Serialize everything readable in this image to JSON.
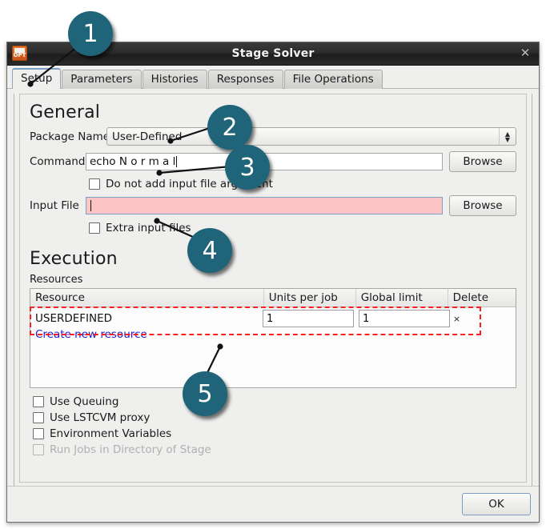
{
  "window": {
    "title": "Stage Solver",
    "icon": "opt-book-icon",
    "icon_text": "OPT",
    "close_label": "✕"
  },
  "tabs": [
    {
      "label": "Setup",
      "active": true
    },
    {
      "label": "Parameters",
      "active": false
    },
    {
      "label": "Histories",
      "active": false
    },
    {
      "label": "Responses",
      "active": false
    },
    {
      "label": "File Operations",
      "active": false
    }
  ],
  "general": {
    "heading": "General",
    "package_name_label": "Package Name",
    "package_name_value": "User-Defined",
    "command_label": "Command",
    "command_value": "echo N o r m a l",
    "browse_label": "Browse",
    "no_input_arg_label": "Do not add input file argument",
    "no_input_arg_checked": false,
    "input_file_label": "Input File",
    "input_file_value": "",
    "input_file_browse_label": "Browse",
    "extra_input_files_label": "Extra input files",
    "extra_input_files_checked": false
  },
  "execution": {
    "heading": "Execution",
    "resources_label": "Resources",
    "table": {
      "columns": [
        "Resource",
        "Units per job",
        "Global limit",
        "Delete"
      ],
      "rows": [
        {
          "resource": "USERDEFINED",
          "units_per_job": "1",
          "global_limit": "1",
          "delete_label": "×"
        }
      ]
    },
    "create_link_label": "Create new resource",
    "options": [
      {
        "label": "Use Queuing",
        "checked": false,
        "disabled": false
      },
      {
        "label": "Use LSTCVM proxy",
        "checked": false,
        "disabled": false
      },
      {
        "label": "Environment Variables",
        "checked": false,
        "disabled": false
      },
      {
        "label": "Run Jobs in Directory of Stage",
        "checked": false,
        "disabled": true
      }
    ]
  },
  "footer": {
    "ok_label": "OK"
  },
  "callouts": [
    {
      "number": "1"
    },
    {
      "number": "2"
    },
    {
      "number": "3"
    },
    {
      "number": "4"
    },
    {
      "number": "5"
    }
  ],
  "colors": {
    "callout_teal": "#1f6478",
    "highlight_red": "#fb1f1f",
    "input_error_pink": "#fcc4c4",
    "link_blue": "#1b1bd2",
    "titlebar_dark": "#2a2a2a"
  }
}
